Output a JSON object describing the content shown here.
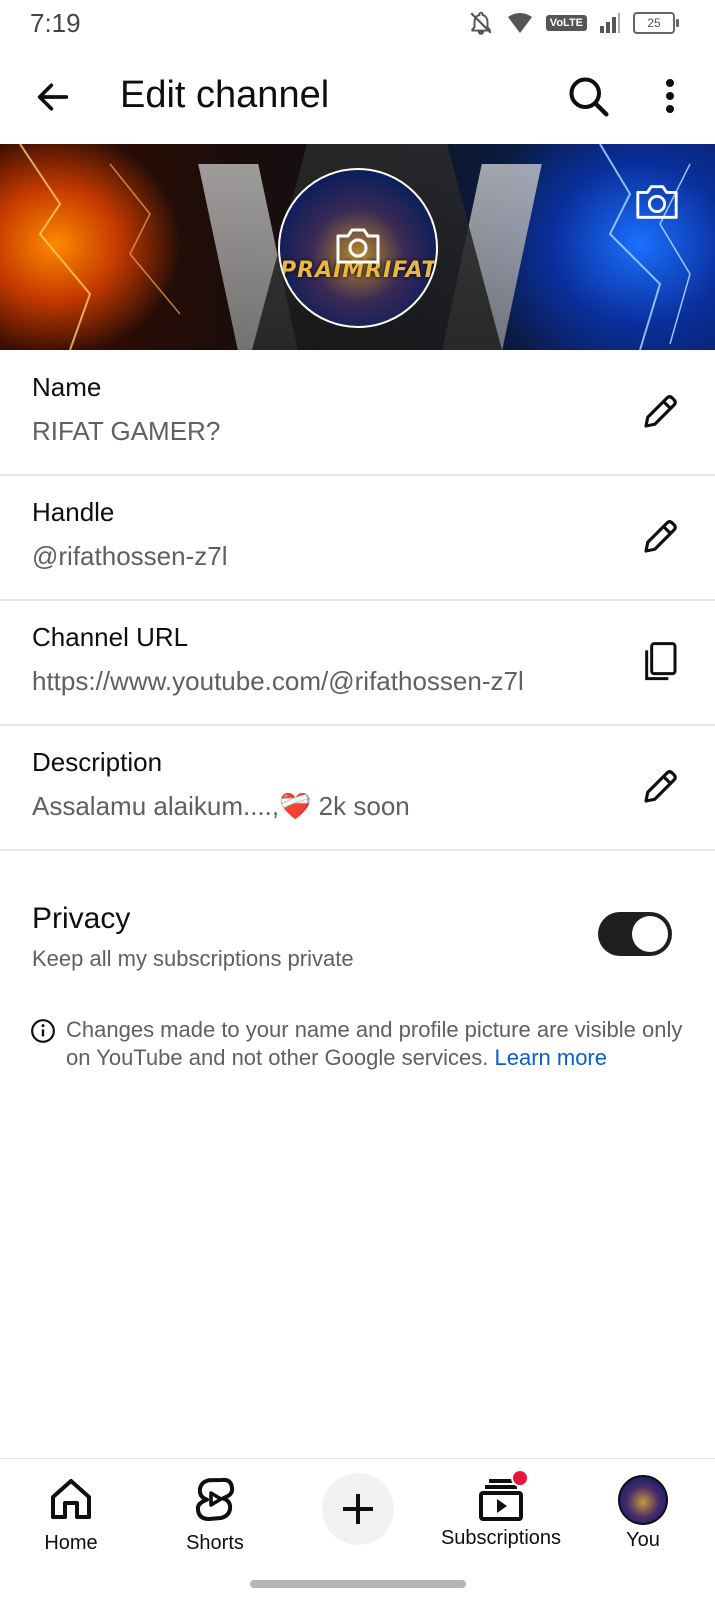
{
  "status_bar": {
    "time": "7:19",
    "network": "VoLTE",
    "battery": "25"
  },
  "app_bar": {
    "title": "Edit channel"
  },
  "avatar": {
    "text": "PRAIMRIFAT"
  },
  "fields": [
    {
      "label": "Name",
      "value": "RIFAT GAMER?",
      "action": "pencil-icon"
    },
    {
      "label": "Handle",
      "value": "@rifathossen-z7l",
      "action": "pencil-icon"
    },
    {
      "label": "Channel URL",
      "value": "https://www.youtube.com/@rifathossen-z7l",
      "action": "copy-icon"
    },
    {
      "label": "Description",
      "value": "Assalamu alaikum....,❤️‍🩹 2k soon",
      "action": "pencil-icon"
    }
  ],
  "privacy": {
    "title": "Privacy",
    "subtitle": "Keep all my subscriptions private",
    "enabled": true
  },
  "info_note": {
    "text": "Changes made to your name and profile picture are visible only on YouTube and not other Google services. ",
    "link": "Learn more"
  },
  "bottom_nav": {
    "home": "Home",
    "shorts": "Shorts",
    "subscriptions": "Subscriptions",
    "you": "You"
  },
  "colors": {
    "link": "#065fd4",
    "notification": "#e51937",
    "toggle_on": "#1f1f1f"
  }
}
